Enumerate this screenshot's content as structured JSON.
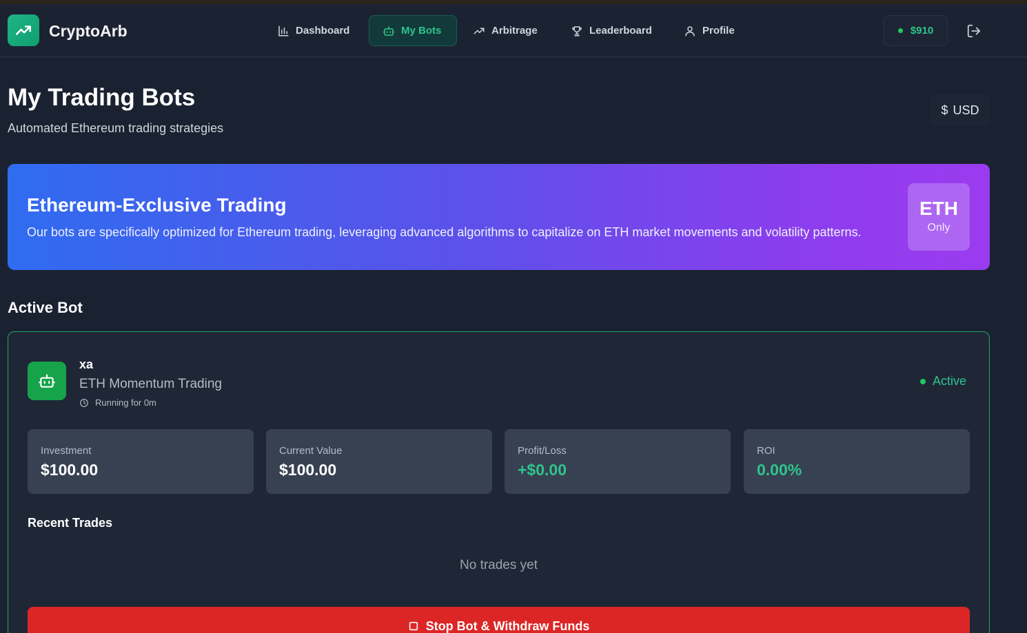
{
  "brand": {
    "name": "CryptoArb"
  },
  "nav": {
    "items": [
      {
        "label": "Dashboard",
        "icon": "bar-chart-icon"
      },
      {
        "label": "My Bots",
        "icon": "bot-icon",
        "active": true
      },
      {
        "label": "Arbitrage",
        "icon": "trending-up-icon"
      },
      {
        "label": "Leaderboard",
        "icon": "trophy-icon"
      },
      {
        "label": "Profile",
        "icon": "user-icon"
      }
    ],
    "balance": "$910"
  },
  "header": {
    "title": "My Trading Bots",
    "subtitle": "Automated Ethereum trading strategies",
    "currency_symbol": "$",
    "currency": "USD"
  },
  "banner": {
    "title": "Ethereum-Exclusive Trading",
    "text": "Our bots are specifically optimized for Ethereum trading, leveraging advanced algorithms to capitalize on ETH market movements and volatility patterns.",
    "badge_main": "ETH",
    "badge_sub": "Only"
  },
  "active_bot": {
    "section_title": "Active Bot",
    "name": "xa",
    "strategy": "ETH Momentum Trading",
    "running": "Running for 0m",
    "status": "Active",
    "stats": [
      {
        "label": "Investment",
        "value": "$100.00"
      },
      {
        "label": "Current Value",
        "value": "$100.00"
      },
      {
        "label": "Profit/Loss",
        "value": "+$0.00"
      },
      {
        "label": "ROI",
        "value": "0.00%"
      }
    ],
    "recent_trades_title": "Recent Trades",
    "no_trades": "No trades yet",
    "stop_button": "Stop Bot & Withdraw Funds"
  },
  "colors": {
    "accent_green": "#2ec48c",
    "danger_red": "#dc2626",
    "banner_start": "#2f6cf0",
    "banner_end": "#9b3bef"
  }
}
